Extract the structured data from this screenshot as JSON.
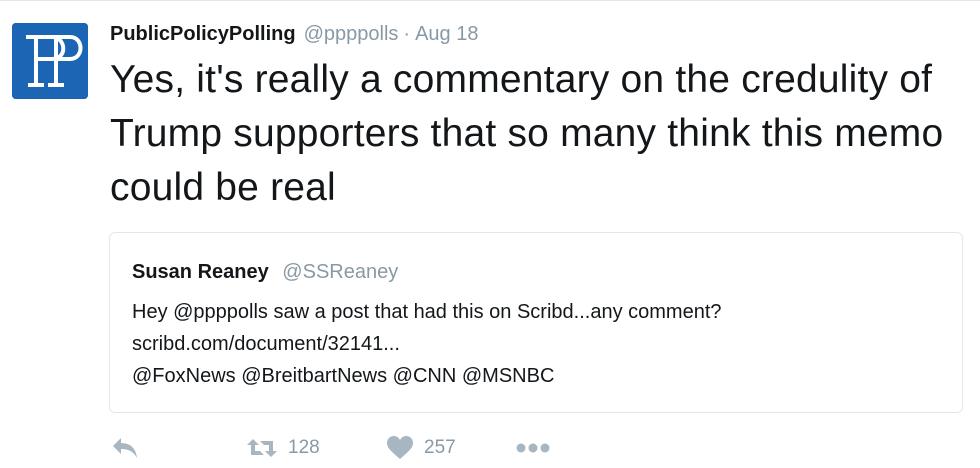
{
  "tweet": {
    "author_name": "PublicPolicyPolling",
    "author_handle": "@ppppolls",
    "separator": "·",
    "date": "Aug 18",
    "text": "Yes, it's really a commentary on the credulity of Trump supporters that so many think this memo could be real"
  },
  "quoted_tweet": {
    "author_name": "Susan Reaney",
    "author_handle": "@SSReaney",
    "line1": "Hey @ppppolls saw a post that had this on Scribd...any comment?",
    "line2": "scribd.com/document/32141...",
    "line3": "@FoxNews @BreitbartNews @CNN @MSNBC"
  },
  "actions": {
    "reply_icon": "reply-icon",
    "retweet_icon": "retweet-icon",
    "retweet_count": "128",
    "like_icon": "heart-icon",
    "like_count": "257",
    "more_icon": "more-icon"
  },
  "colors": {
    "avatar_blue": "#1c64b4",
    "muted_text": "#8899a6",
    "icon_gray": "#a8b6c2",
    "border": "#e1e8ed"
  }
}
